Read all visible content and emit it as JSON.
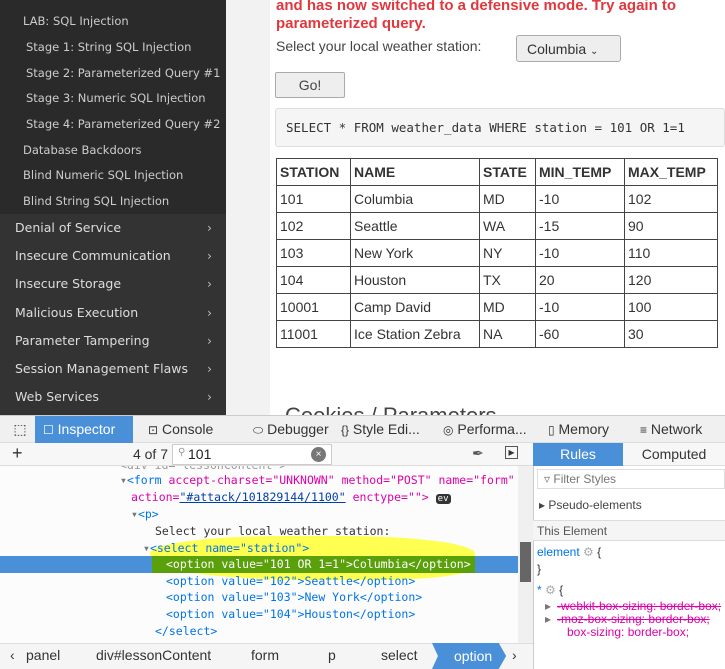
{
  "sidebar": {
    "sub_items": [
      "LAB: SQL Injection",
      "Stage 1: String SQL Injection",
      "Stage 2: Parameterized Query #1",
      "Stage 3: Numeric SQL Injection",
      "Stage 4: Parameterized Query #2",
      "Database Backdoors",
      "Blind Numeric SQL Injection",
      "Blind String SQL Injection"
    ],
    "items": [
      "Denial of Service",
      "Insecure Communication",
      "Insecure Storage",
      "Malicious Execution",
      "Parameter Tampering",
      "Session Management Flaws",
      "Web Services"
    ]
  },
  "lesson": {
    "warning_line1": "and has now switched to a defensive mode. Try again to",
    "warning_line2": "parameterized query.",
    "select_label": "Select your local weather station:",
    "select_value": "Columbia",
    "go_label": "Go!",
    "sql": "SELECT * FROM weather_data WHERE station = 101 OR 1=1",
    "table": {
      "headers": [
        "STATION",
        "NAME",
        "STATE",
        "MIN_TEMP",
        "MAX_TEMP"
      ],
      "rows": [
        [
          "101",
          "Columbia",
          "MD",
          "-10",
          "102"
        ],
        [
          "102",
          "Seattle",
          "WA",
          "-15",
          "90"
        ],
        [
          "103",
          "New York",
          "NY",
          "-10",
          "110"
        ],
        [
          "104",
          "Houston",
          "TX",
          "20",
          "120"
        ],
        [
          "10001",
          "Camp David",
          "MD",
          "-10",
          "100"
        ],
        [
          "11001",
          "Ice Station Zebra",
          "NA",
          "-60",
          "30"
        ]
      ]
    },
    "next_section": "Cookies / Parameters"
  },
  "devtools": {
    "tabs": [
      "Inspector",
      "Console",
      "Debugger",
      "Style Edi...",
      "Performa...",
      "Memory",
      "Network"
    ],
    "search_count": "4 of 7",
    "search_value": "101",
    "markup": {
      "form_tag": "<form",
      "form_attrs": " accept-charset=\"UNKNOWN\" method=\"POST\" name=\"form\"",
      "action_attr": "action=",
      "action_value": "\"#attack/101829144/1100\"",
      "enctype": " enctype=\"\">",
      "ev": "ev",
      "p_tag": "<p>",
      "text": "Select your local weather station:",
      "select_tag": "<select name=\"station\">",
      "options": [
        "<option value=\"101 OR 1=1\">Columbia</option>",
        "<option value=\"102\">Seattle</option>",
        "<option value=\"103\">New York</option>",
        "<option value=\"104\">Houston</option>"
      ],
      "select_close": "</select>"
    },
    "breadcrumbs": [
      "panel",
      "div#lessonContent",
      "form",
      "p",
      "select",
      "option"
    ],
    "rules_tabs": [
      "Rules",
      "Computed"
    ],
    "filter_placeholder": "Filter Styles",
    "pseudo": "Pseudo-elements",
    "this_element": "This Element",
    "element_rule": "element",
    "star_rule": "*",
    "props": [
      "-webkit-box-sizing: border-box;",
      "-moz-box-sizing: border-box;",
      "box-sizing: border-box;"
    ]
  },
  "colors": {
    "accent": "#4a90d9",
    "warning": "#e0383e",
    "highlight": "#ffff33"
  }
}
